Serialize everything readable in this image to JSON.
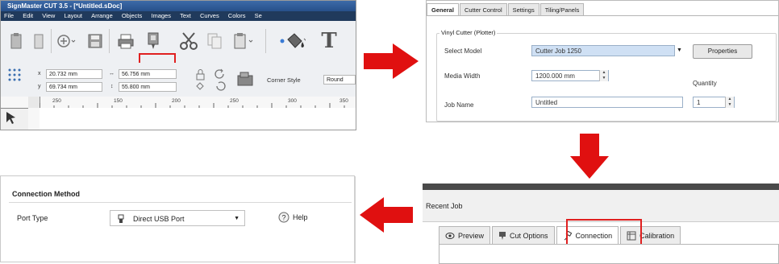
{
  "colors": {
    "arrow": "#e01010",
    "highlight": "#e02020",
    "titlebar": "#2f5c97"
  },
  "panel_a": {
    "window_title": "SignMaster CUT 3.5 - [*Untitled.sDoc]",
    "menu": [
      "File",
      "Edit",
      "View",
      "Layout",
      "Arrange",
      "Objects",
      "Images",
      "Text",
      "Curves",
      "Colors",
      "Se"
    ],
    "toolbar_icons": [
      "paste-icon",
      "add-icon",
      "save-icon",
      "print-icon",
      "cutter-icon",
      "cut-scissors-icon",
      "copy-icon",
      "clipboard-icon",
      "paint-bucket-icon",
      "text-tool-icon"
    ],
    "x_value": "20.732 mm",
    "y_value": "69.734 mm",
    "width_value": "56.756 mm",
    "height_value": "55.800 mm",
    "corner_style_label": "Corner Style",
    "corner_style_value": "Round",
    "ruler_ticks": [
      "250",
      "150",
      "200",
      "250",
      "300",
      "350"
    ]
  },
  "panel_b": {
    "tabs": [
      "General",
      "Cutter Control",
      "Settings",
      "Tiling/Panels"
    ],
    "group_title": "Vinyl Cutter (Plotter)",
    "select_model_label": "Select Model",
    "select_model_value": "Cutter Job 1250",
    "properties_button": "Properties",
    "media_width_label": "Media Width",
    "media_width_value": "1200.000 mm",
    "quantity_label": "Quantity",
    "quantity_value": "1",
    "job_name_label": "Job Name",
    "job_name_value": "Untitled"
  },
  "panel_c": {
    "title": "Recent Job",
    "tabs": [
      "Preview",
      "Cut Options",
      "Connection",
      "Calibration"
    ]
  },
  "panel_d": {
    "section_title": "Connection Method",
    "port_type_label": "Port Type",
    "port_type_value": "Direct USB Port",
    "help_button": "Help"
  }
}
